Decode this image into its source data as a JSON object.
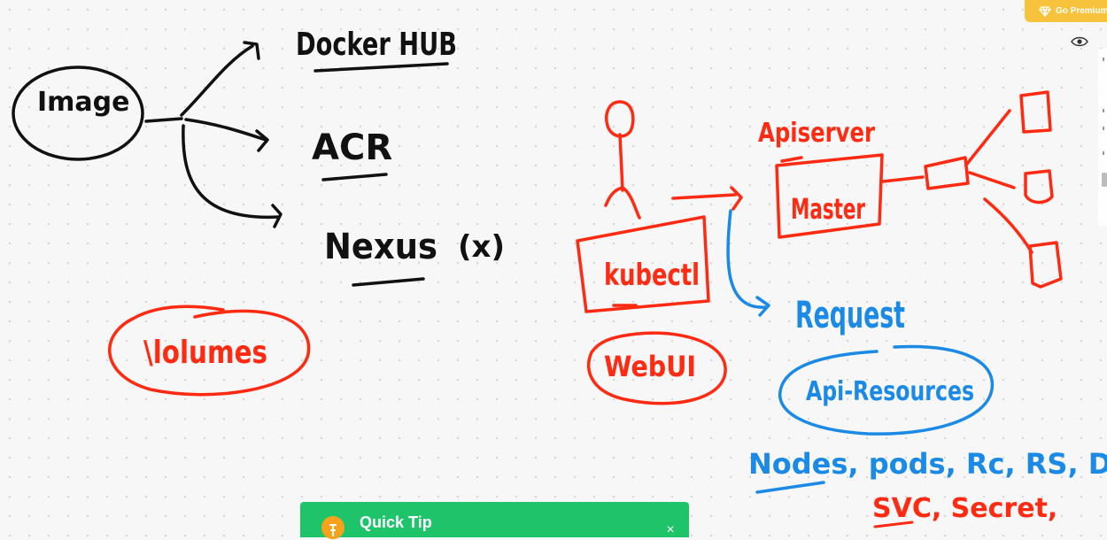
{
  "premium": {
    "label": "Go Premium",
    "icon": "diamond-icon",
    "color": "#f8c33c"
  },
  "visibility": {
    "icon": "eye-icon"
  },
  "quick_tip": {
    "title": "Quick Tip",
    "close_icon": "close-icon",
    "close_glyph": "×",
    "color": "#1fc46a"
  },
  "sketch": {
    "colors": {
      "black": "#111111",
      "red": "#ff2a12",
      "blue": "#1a8ae6"
    },
    "image": "Image",
    "docker_hub": "Docker HUB",
    "acr": "ACR",
    "nexus": "Nexus",
    "nexus_note": "(x)",
    "volumes": "\\lolumes",
    "apiserver": "Apiserver",
    "master": "Master",
    "kubectl": "kubectl",
    "webui": "WebUI",
    "request": "Request",
    "api_resources": "Api-Resources",
    "resources_line1": [
      "Nodes",
      ", pods",
      ", Rc",
      ", RS",
      ", Deploy"
    ],
    "resources_line2": [
      "SVC",
      ", Secret",
      ","
    ]
  }
}
